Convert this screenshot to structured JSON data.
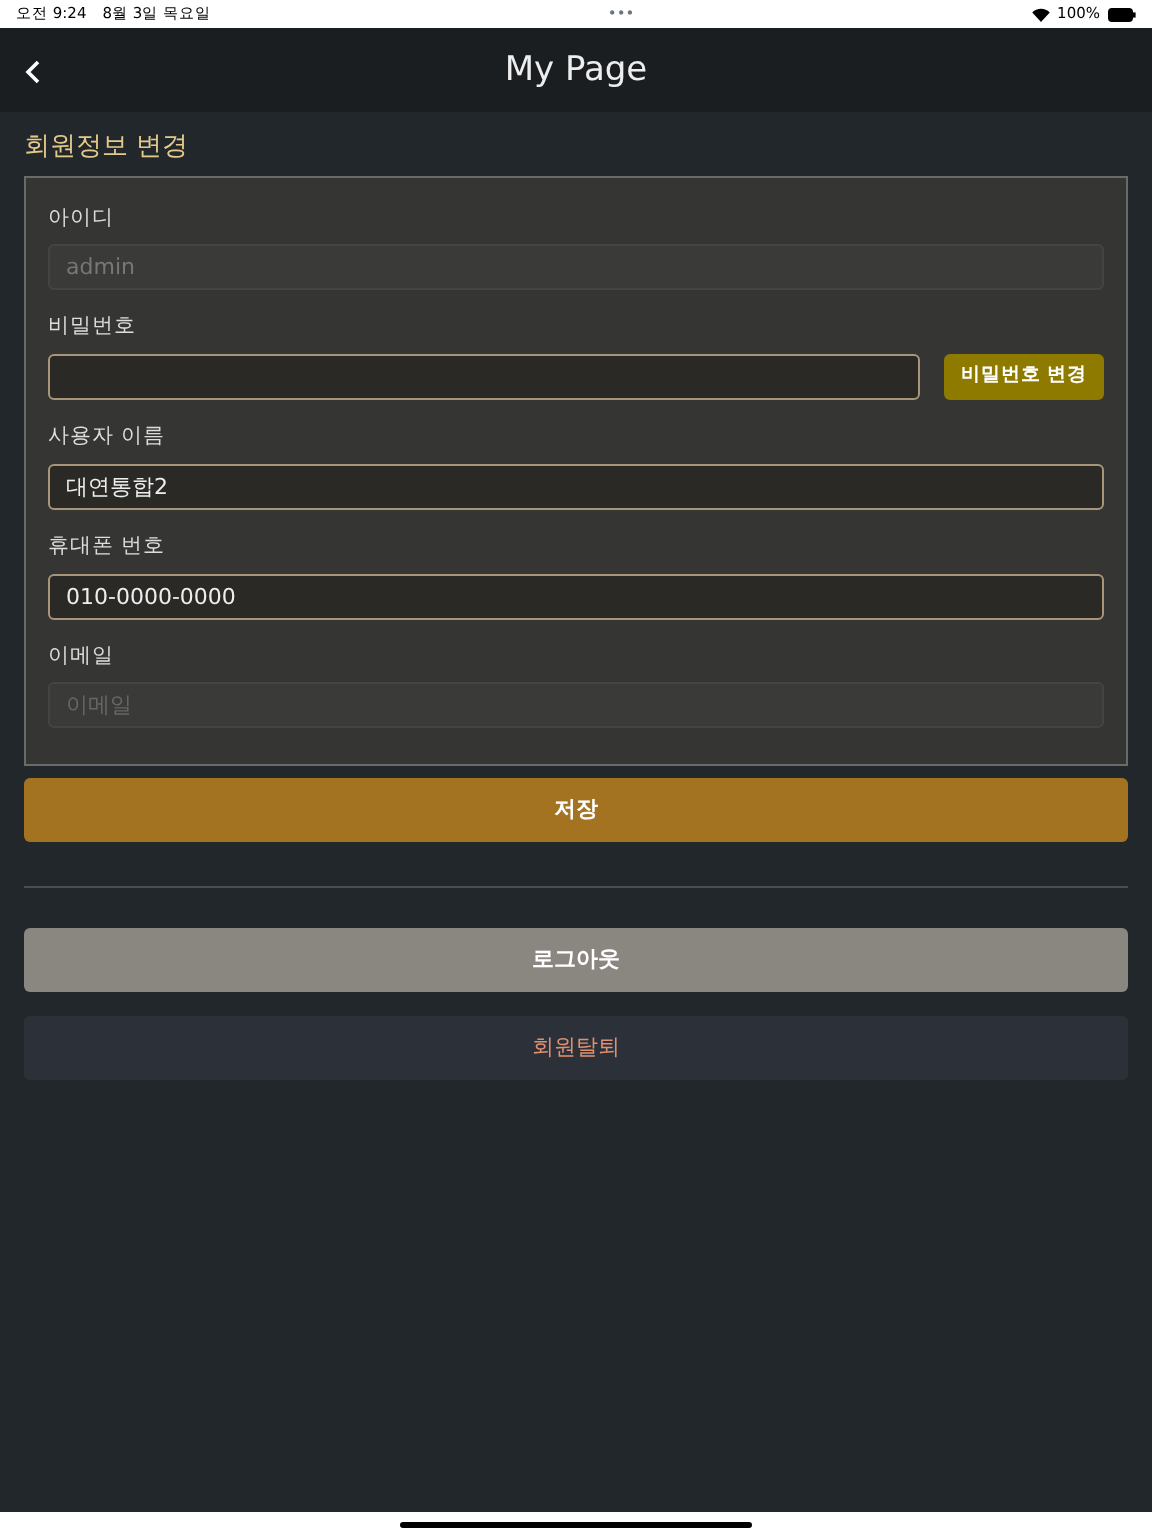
{
  "status_bar": {
    "time": "오전 9:24",
    "date": "8월 3일 목요일",
    "dots": "•••",
    "battery": "100%"
  },
  "nav": {
    "title": "My Page"
  },
  "section_title": "회원정보 변경",
  "fields": [
    {
      "label": "아이디",
      "value": "admin",
      "disabled": true
    },
    {
      "label": "비밀번호",
      "disabled": false,
      "button": "비밀번호 변경"
    },
    {
      "label": "사용자 이름",
      "value": "대연통합2",
      "disabled": false
    },
    {
      "label": "휴대폰 번호",
      "value": "010-0000-0000",
      "disabled": false
    },
    {
      "label": "이메일",
      "placeholder": "이메일",
      "disabled": true
    }
  ],
  "save_button": "저장",
  "logout_button": "로그아웃",
  "withdraw_button": "회원탈퇴"
}
